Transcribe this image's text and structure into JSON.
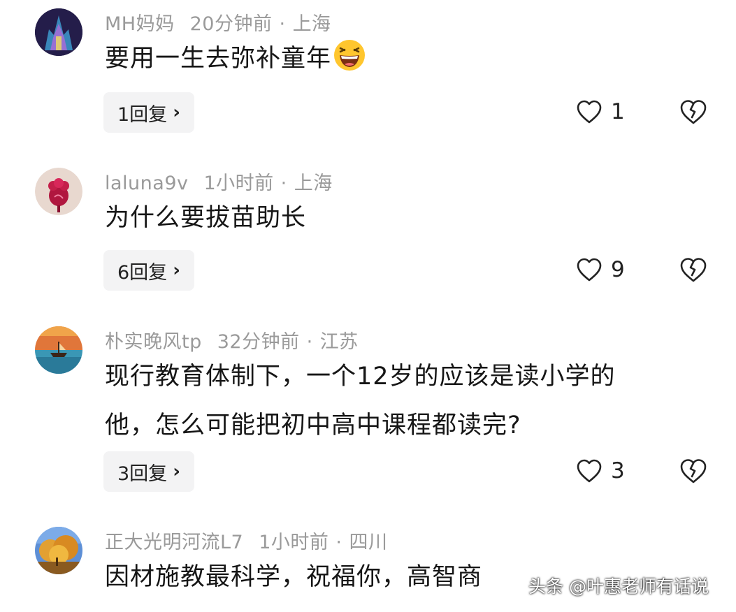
{
  "comments": [
    {
      "username": "MH妈妈",
      "time": "20分钟前",
      "separator": "·",
      "location": "上海",
      "text": "要用一生去弥补童年",
      "emoji": "laughing-emoji",
      "replies_label": "1回复",
      "likes": "1"
    },
    {
      "username": "laluna9v",
      "time": "1小时前",
      "separator": "·",
      "location": "上海",
      "text": "为什么要拔苗助长",
      "replies_label": "6回复",
      "likes": "9"
    },
    {
      "username": "朴实晚风tp",
      "time": "32分钟前",
      "separator": "·",
      "location": "江苏",
      "text_line1": "现行教育体制下，一个12岁的应该是读小学的",
      "text_line2": "他，怎么可能把初中高中课程都读完?",
      "replies_label": "3回复",
      "likes": "3"
    },
    {
      "username": "正大光明河流L7",
      "time": "1小时前",
      "separator": "·",
      "location": "四川",
      "text": "因材施教最科学，祝福你，高智商"
    }
  ],
  "icons": {
    "reply_chevron": "chevron-right-icon",
    "like": "heart-outline-icon",
    "dislike": "broken-heart-icon"
  },
  "watermark": "头条 @叶惠老师有话说",
  "colors": {
    "meta_text": "#9a9a9a",
    "reply_bg": "#f3f3f4",
    "body_text": "#161616"
  }
}
